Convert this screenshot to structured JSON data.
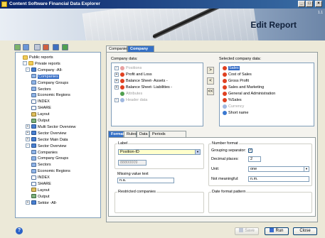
{
  "window": {
    "title": "Content Software Financial Data Explorer",
    "min": "_",
    "max": "□",
    "close": "×",
    "version": "1.1"
  },
  "banner": {
    "title": "Edit Report"
  },
  "tree": {
    "rows": [
      {
        "label": "Public reports",
        "icon": "folder",
        "ex": ""
      },
      {
        "label": "Private reports",
        "icon": "folder",
        "ex": "-"
      },
      {
        "label": "Company -All-",
        "icon": "db",
        "ex": "-"
      },
      {
        "label": "Companies",
        "icon": "mod",
        "ex": "",
        "selected": true
      },
      {
        "label": "Company Groups",
        "icon": "mod",
        "ex": ""
      },
      {
        "label": "Sectors",
        "icon": "mod",
        "ex": ""
      },
      {
        "label": "Economic Regions",
        "icon": "mod",
        "ex": ""
      },
      {
        "label": "INDEX",
        "icon": "list",
        "ex": ""
      },
      {
        "label": "SHARE",
        "icon": "list",
        "ex": ""
      },
      {
        "label": "Layout",
        "icon": "layout",
        "ex": ""
      },
      {
        "label": "Output",
        "icon": "output",
        "ex": ""
      },
      {
        "label": "Multi Sector Overview",
        "icon": "db",
        "ex": "+"
      },
      {
        "label": "Sector Overview",
        "icon": "db",
        "ex": "+"
      },
      {
        "label": "Sector Main Data",
        "icon": "db",
        "ex": "+"
      },
      {
        "label": "Sector Overview",
        "icon": "db",
        "ex": "-"
      },
      {
        "label": "Companies",
        "icon": "mod",
        "ex": ""
      },
      {
        "label": "Company Groups",
        "icon": "mod",
        "ex": ""
      },
      {
        "label": "Sectors",
        "icon": "mod",
        "ex": ""
      },
      {
        "label": "Economic Regions",
        "icon": "mod",
        "ex": ""
      },
      {
        "label": "INDEX",
        "icon": "list",
        "ex": ""
      },
      {
        "label": "SHARE",
        "icon": "list",
        "ex": ""
      },
      {
        "label": "Layout",
        "icon": "layout",
        "ex": ""
      },
      {
        "label": "Output",
        "icon": "output",
        "ex": ""
      },
      {
        "label": "Sektor -All-",
        "icon": "db",
        "ex": "+"
      }
    ]
  },
  "tabs": [
    "Companies",
    "Company Data"
  ],
  "company_data": {
    "label": "Company data:",
    "items": [
      {
        "label": "Positions",
        "disabled": true,
        "ex": "+"
      },
      {
        "label": "Profit and Loss",
        "disabled": false,
        "ex": "+"
      },
      {
        "label": "Balance Sheet- Assets -",
        "disabled": false,
        "ex": "+"
      },
      {
        "label": "Balance Sheet- Liabilities -",
        "disabled": false,
        "ex": "+"
      },
      {
        "label": "Attributes",
        "disabled": true,
        "ex": ""
      },
      {
        "label": "Header data",
        "disabled": true,
        "ex": "+"
      }
    ]
  },
  "move_buttons": [
    ">",
    "<",
    "<<"
  ],
  "selected_data": {
    "label": "Selected company data:",
    "items": [
      {
        "label": "Sales",
        "color": "#e04020",
        "selected": true,
        "disabled": false
      },
      {
        "label": "Cost of Sales",
        "color": "#e04020",
        "selected": false,
        "disabled": false
      },
      {
        "label": "Gross Profit",
        "color": "#e04020",
        "selected": false,
        "disabled": false
      },
      {
        "label": "Sales and Marketing",
        "color": "#e04020",
        "selected": false,
        "disabled": false
      },
      {
        "label": "General and Administration",
        "color": "#e04020",
        "selected": false,
        "disabled": false
      },
      {
        "label": "%Sales",
        "color": "#e04020",
        "selected": false,
        "disabled": false
      },
      {
        "label": "Currency",
        "color": "#a0b8e0",
        "selected": false,
        "disabled": true
      },
      {
        "label": "Short name",
        "color": "#3a78d0",
        "selected": false,
        "disabled": false
      }
    ]
  },
  "subtabs": [
    "Format",
    "Rules",
    "Data",
    "Periods (mult.ent.)"
  ],
  "format": {
    "label_group": "Label",
    "label_value": "Position-ID",
    "label_code": "88800009",
    "missing_title": "Missing value text",
    "missing_value": "n.a.",
    "restricted_title": "Restricted companies",
    "number_format_title": "Number format",
    "grouping_label": "Grouping separator:",
    "grouping_checked": "✓",
    "decimal_label": "Decimal places:",
    "decimal_value": "2",
    "unit_label": "Unit:",
    "unit_value": "one",
    "notmeaningful_label": "Not meaningful:",
    "notmeaningful_value": "n.m.",
    "date_format_title": "Date format pattern"
  },
  "footer": {
    "help": "?",
    "save": "Save",
    "run": "Run",
    "close": "Close"
  }
}
